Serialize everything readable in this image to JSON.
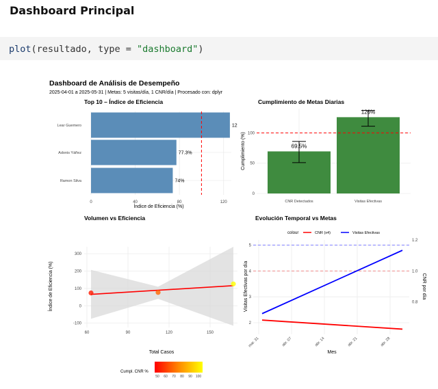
{
  "page": {
    "heading": "Dashboard Principal",
    "code": {
      "fn": "plot",
      "open": "(resultado, ",
      "arg": "type",
      "eq": " = ",
      "value": "\"dashboard\"",
      "close": ")"
    }
  },
  "dashboard": {
    "title": "Dashboard de Análisis de Desempeño",
    "subtitle": "2025-04-01 a 2025-05-31 | Metas: 5 visitas/día, 1 CNR/día | Procesado con: dplyr"
  },
  "colors": {
    "bar_blue": "#5b8db8",
    "bar_green": "#3f8b3f",
    "red": "#ff0000",
    "blue": "#0000ff"
  },
  "chart_data": [
    {
      "type": "bar",
      "orientation": "horizontal",
      "title": "Top 10 – Índice de Eficiencia",
      "xlabel": "Índice de Eficiencia (%)",
      "categories": [
        "Lear Guemero",
        "Adonis Yáñez",
        "Ramon Silva"
      ],
      "values": [
        125.7,
        77.3,
        74
      ],
      "value_labels": [
        "12",
        "77.3%",
        "74%"
      ],
      "xticks": [
        "0",
        "40",
        "80",
        "120"
      ],
      "xlim": [
        0,
        127
      ],
      "reference_line": 100
    },
    {
      "type": "bar",
      "title": "Cumplimiento de Metas Diarias",
      "ylabel": "Cumplimiento (%)",
      "categories": [
        "CNR Detectados",
        "Visitas Efectivas"
      ],
      "values": [
        69.5,
        126
      ],
      "error_low": [
        51,
        111
      ],
      "error_high": [
        86,
        137
      ],
      "value_labels": [
        "69.5%",
        "126%"
      ],
      "yticks": [
        "0",
        "50",
        "100"
      ],
      "ylim": [
        0,
        140
      ],
      "reference_line": 100
    },
    {
      "type": "scatter",
      "title": "Volumen vs Eficiencia",
      "xlabel": "Total Casos",
      "ylabel": "Índice de Eficiencia (%)",
      "points": [
        {
          "x": 63,
          "y": 74,
          "cnr": 55
        },
        {
          "x": 112,
          "y": 77,
          "cnr": 70
        },
        {
          "x": 167,
          "y": 126,
          "cnr": 100
        }
      ],
      "trend": {
        "x": [
          63,
          167
        ],
        "y": [
          66,
          116
        ]
      },
      "band_upper": {
        "x": [
          63,
          112,
          167
        ],
        "y": [
          207,
          110,
          340
        ]
      },
      "band_lower": {
        "x": [
          63,
          112,
          167
        ],
        "y": [
          -75,
          40,
          -115
        ]
      },
      "xticks": [
        "60",
        "90",
        "120",
        "150"
      ],
      "yticks": [
        "-100",
        "0",
        "100",
        "200",
        "300"
      ],
      "xlim": [
        58,
        170
      ],
      "ylim": [
        -125,
        340
      ],
      "legend": {
        "title": "Cumpl. CNR %",
        "labels": [
          "50",
          "60",
          "70",
          "80",
          "90",
          "100"
        ]
      }
    },
    {
      "type": "line",
      "title": "Evolución Temporal vs Metas",
      "xlabel": "Mes",
      "ylabel": "Visitas Efectivas por día",
      "ylabel_right": "CNR por día",
      "legend_title": "colour",
      "series": [
        {
          "name": "CNR (x4)",
          "x": [
            "2025-04-01",
            "2025-05-31"
          ],
          "y": [
            2.1,
            1.75
          ]
        },
        {
          "name": "Visitas Efectivas",
          "x": [
            "2025-04-01",
            "2025-05-31"
          ],
          "y": [
            2.35,
            4.8
          ]
        }
      ],
      "xticks": [
        "mar. 31",
        "abr. 07",
        "abr. 14",
        "abr. 21",
        "abr. 28"
      ],
      "yticks": [
        "2",
        "3",
        "4",
        "5"
      ],
      "yticks_right": [
        "0.8",
        "1.0",
        "1.2"
      ],
      "ylim": [
        1.55,
        5.2
      ],
      "goal_lines": [
        {
          "y": 5,
          "color": "#8080ff"
        },
        {
          "y": 4,
          "color": "#ee8b8b"
        }
      ]
    }
  ]
}
